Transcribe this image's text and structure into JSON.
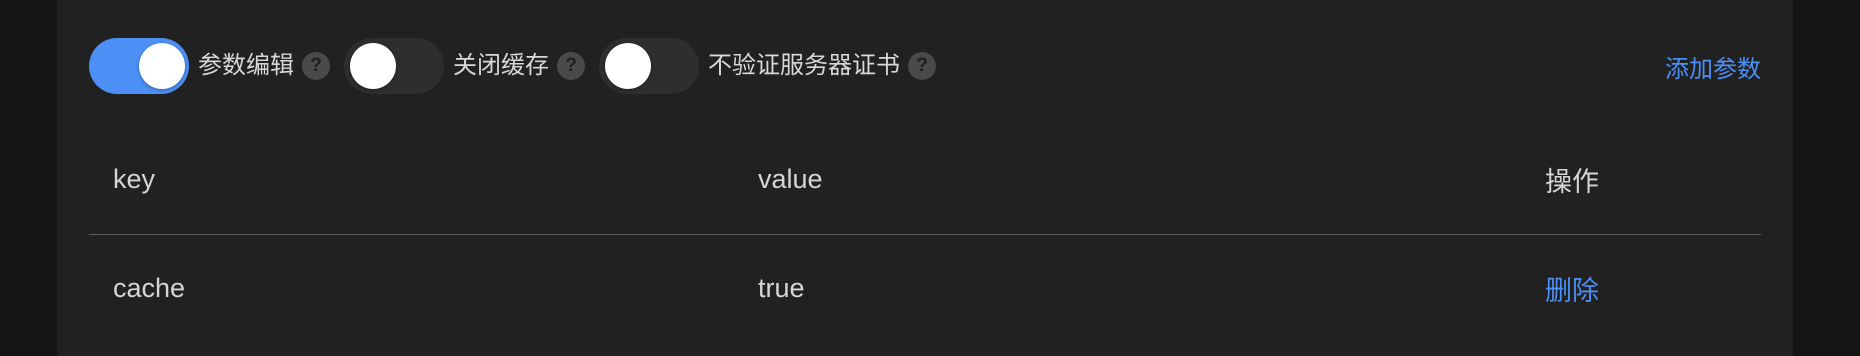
{
  "toolbar": {
    "toggles": [
      {
        "label": "参数编辑",
        "on": true
      },
      {
        "label": "关闭缓存",
        "on": false
      },
      {
        "label": "不验证服务器证书",
        "on": false
      }
    ],
    "help_glyph": "?",
    "add_param_label": "添加参数"
  },
  "table": {
    "columns": [
      "key",
      "value",
      "操作"
    ],
    "rows": [
      {
        "key": "cache",
        "value": "true",
        "action": "删除"
      }
    ]
  },
  "colors": {
    "accent": "#4c8ff5",
    "panel_bg": "#212121",
    "page_bg": "#151515"
  }
}
